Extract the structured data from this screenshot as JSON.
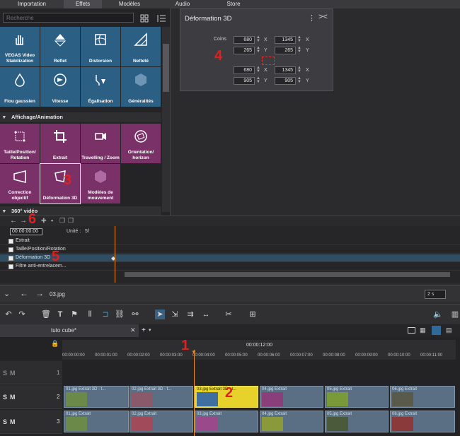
{
  "top_tabs": [
    "Importation",
    "Effets",
    "Modèles",
    "Audio",
    "Store"
  ],
  "search": {
    "placeholder": "Recherche"
  },
  "tiles_row1": [
    "VEGAS Video Stabilization",
    "Reflet",
    "Distorsion",
    "Netteté"
  ],
  "tiles_row2": [
    "Flou gaussien",
    "Vitesse",
    "Égalisation",
    "Généralités"
  ],
  "section_affichage": "Affichage/Animation",
  "tiles_row3": [
    "Taille/Position/ Rotation",
    "Extrait",
    "Travelling / Zoom",
    "Orientation/ horizon"
  ],
  "tiles_row4": [
    "Correction objectif",
    "Déformation 3D",
    "Modèles de mouvement"
  ],
  "section_360": "360° vidéo",
  "deform": {
    "title": "Déformation 3D",
    "coins_label": "Coins",
    "v1": "680",
    "v2": "1345",
    "v3": "265",
    "v4": "265",
    "v5": "680",
    "v6": "1345",
    "v7": "905",
    "v8": "905",
    "x": "X",
    "y": "Y"
  },
  "keyframes": {
    "time": "00:00:00:00",
    "unit_label": "Unité :",
    "unit_value": "5f",
    "tracks": [
      "Extrait",
      "Taille/Position/Rotation",
      "Déformation 3D",
      "Filtre anti-entrelacem..."
    ]
  },
  "path": {
    "file": "03.jpg",
    "duration": "2 s"
  },
  "project": {
    "tab": "tuto cube*",
    "add": "+"
  },
  "ruler": {
    "top_time": "00:00:12:00",
    "ticks": [
      "00:00:00:00",
      "00:00:01:00",
      "00:00:02:00",
      "00:00:03:00",
      "00:00:04:00",
      "00:00:05:00",
      "00:00:06:00",
      "00:00:07:00",
      "00:00:08:00",
      "00:00:09:00",
      "00:00:10:00",
      "00:00:11:00"
    ]
  },
  "tracks": [
    "1",
    "2",
    "3"
  ],
  "track_letters": [
    "S",
    "M"
  ],
  "clips_track2": [
    "01.jpg Extrait 3D - t...",
    "02.jpg Extrait 3D - t...",
    "03.jpg Extrait 3D - t...",
    "04.jpg Extrait",
    "05.jpg Extrait",
    "06.jpg Extrait"
  ],
  "clips_track3": [
    "01.jpg Extrait",
    "02.jpg Extrait",
    "03.jpg Extrait",
    "04.jpg Extrait",
    "05.jpg Extrait",
    "06.jpg Extrait"
  ],
  "annotations": [
    "1",
    "2",
    "3",
    "4",
    "5",
    "6"
  ],
  "colors": {
    "tile_blue": "#2c5f84",
    "tile_purple": "#7a3168",
    "clip_selected": "#e6d22a",
    "playhead": "#f08a1e",
    "annotation": "#e02020"
  }
}
